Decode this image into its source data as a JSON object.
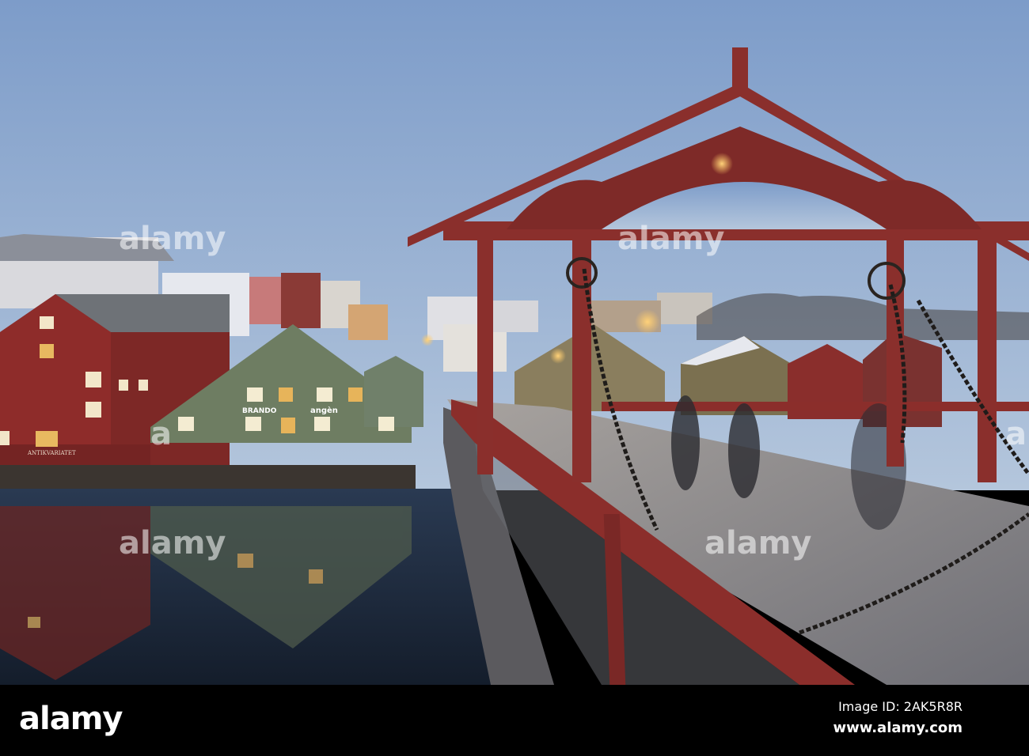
{
  "photo": {
    "signs": {
      "left_building": "ANTIKVARIATET",
      "green_building_1": "BRANDO",
      "green_building_2": "angèn"
    },
    "watermarks": [
      "alamy",
      "alamy",
      "alamy",
      "alamy",
      "alamy",
      "a",
      "a"
    ]
  },
  "footer": {
    "logo": "alamy",
    "image_id": "Image ID: 2AK5R8R",
    "website": "www.alamy.com"
  },
  "colors": {
    "sky_top": "#7f9dc9",
    "sky_bottom": "#b2c4da",
    "bridge_red": "#8a2f2c",
    "water": "#1d2a3c",
    "green_building": "#6e7d62"
  }
}
